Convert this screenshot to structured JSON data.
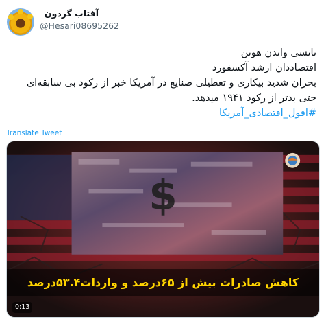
{
  "author": {
    "display_name": "آفتاب گردون",
    "handle": "@Hesari08695262",
    "avatar_icon": "sunflower-avatar"
  },
  "tweet": {
    "lines": [
      "نانسی واندن هوتن",
      "اقتصاددان ارشد آکسفورد",
      "بحران شدید بیکاری و تعطیلی صنایع در آمریکا خبر از رکود بی سابقه‌ای",
      "حتی بدتر از رکود ۱۹۴۱ میدهد."
    ],
    "hashtag": "#افول_اقتصادی_آمریکا",
    "translate_label": "Translate Tweet"
  },
  "video": {
    "duration": "0:13",
    "caption": "کاهش صادرات بیش از ۶۵درصد و واردات۵۳.۴درصد",
    "channel_icon": "news-channel-logo-icon"
  },
  "colors": {
    "link": "#1d9bf0",
    "caption_text": "#ffd400",
    "secondary_text": "#536471"
  }
}
